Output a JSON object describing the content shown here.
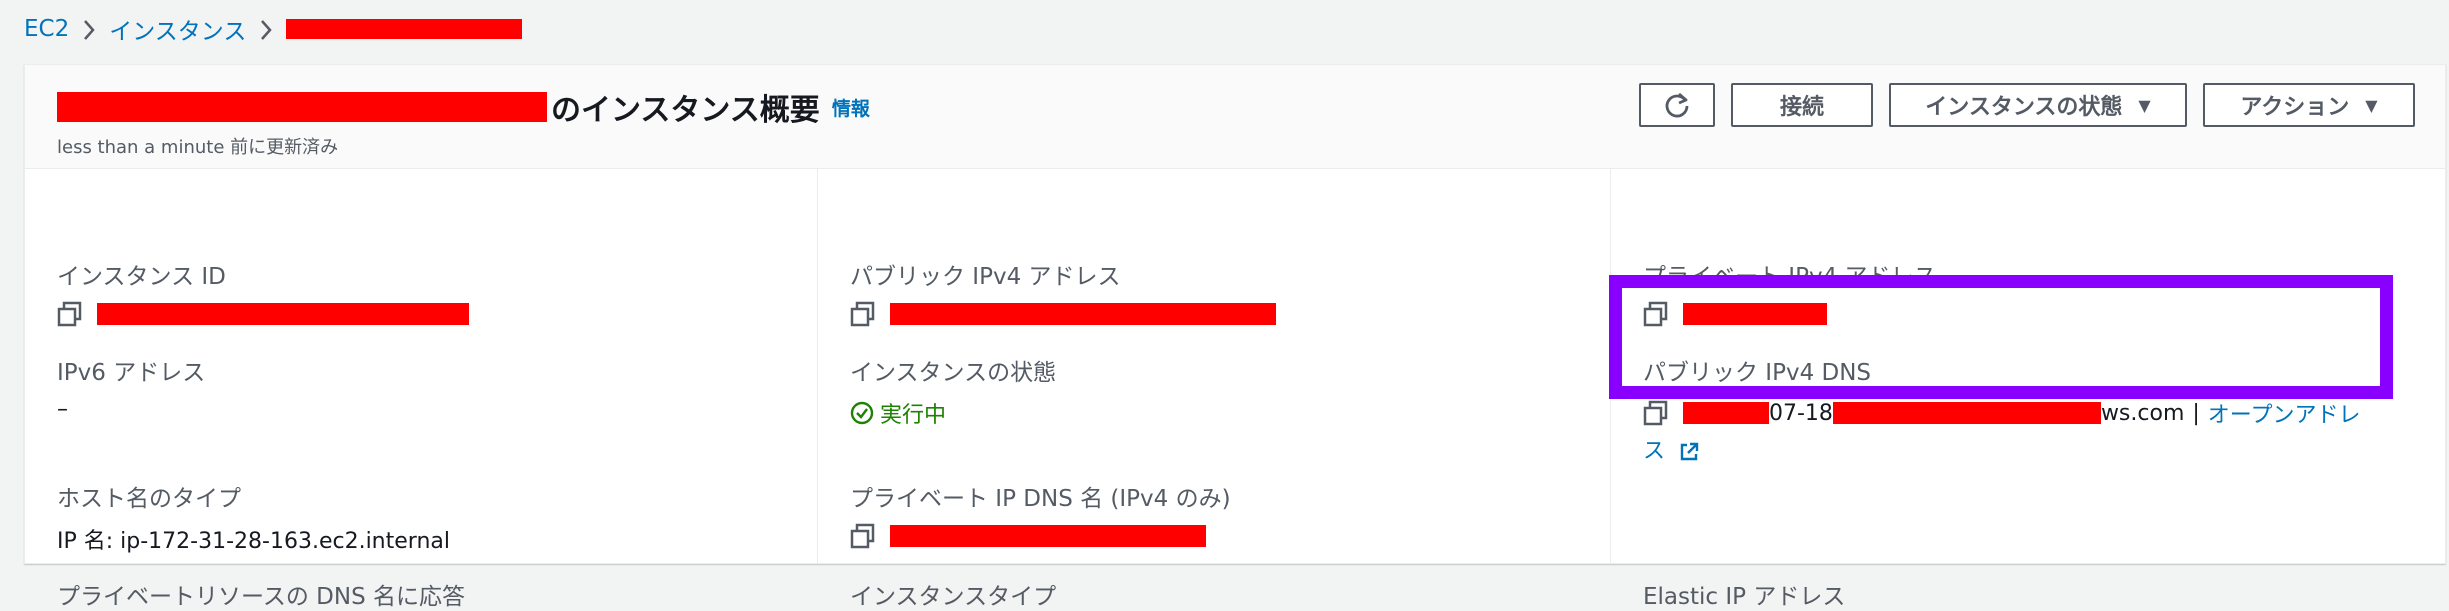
{
  "breadcrumb": {
    "root": "EC2",
    "instances": "インスタンス"
  },
  "header": {
    "title_suffix": "のインスタンス概要",
    "info_link": "情報",
    "subtitle": "less than a minute 前に更新済み"
  },
  "actions": {
    "connect": "接続",
    "instance_state": "インスタンスの状態",
    "actions": "アクション"
  },
  "fields": {
    "instance_id_label": "インスタンス ID",
    "public_ipv4_label": "パブリック IPv4 アドレス",
    "private_ipv4_label": "プライベート IPv4 アドレス",
    "ipv6_label": "IPv6 アドレス",
    "ipv6_value": "–",
    "instance_state_label": "インスタンスの状態",
    "instance_state_value": "実行中",
    "public_dns_label": "パブリック IPv4 DNS",
    "public_dns_part1": "07-18",
    "public_dns_part2": "ws.com",
    "public_dns_sep": "|",
    "open_address": "オープンアドレ",
    "open_address_wrap": "ス",
    "hostname_type_label": "ホスト名のタイプ",
    "hostname_type_value": "IP 名: ip-172-31-28-163.ec2.internal",
    "private_dns_label": "プライベート IP DNS 名 (IPv4 のみ)",
    "private_resource_dns_label": "プライベートリソースの DNS 名に応答",
    "instance_type_label": "インスタンスタイプ",
    "elastic_ip_label": "Elastic IP アドレス"
  },
  "colors": {
    "link": "#0073bb",
    "running": "#1d8102",
    "highlight": "#8a00ff",
    "redaction": "#ff0000"
  }
}
